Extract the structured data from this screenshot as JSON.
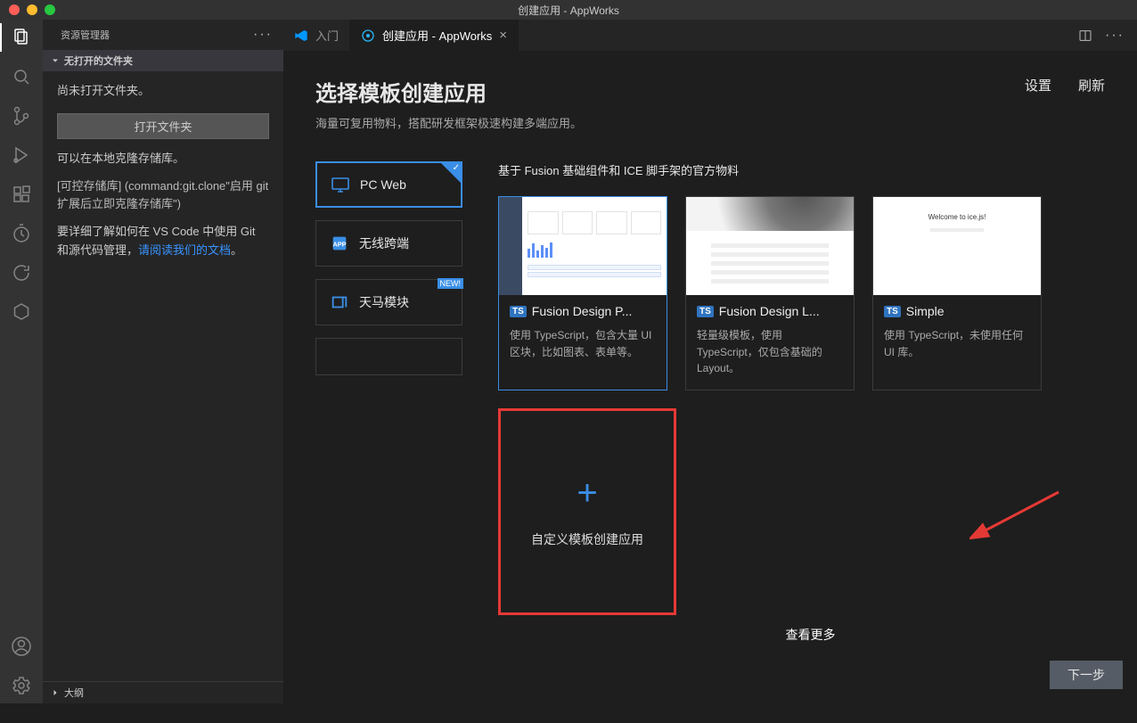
{
  "window": {
    "title": "创建应用 - AppWorks"
  },
  "sidebar": {
    "header": "资源管理器",
    "section": "无打开的文件夹",
    "no_folder": "尚未打开文件夹。",
    "open_folder_btn": "打开文件夹",
    "clone_hint": "可以在本地克隆存储库。",
    "clone_cmd1": "[可控存储库] (command:git.clone\"启用 git 扩展后立即克隆存储库\")",
    "git_hint_prefix": "要详细了解如何在 VS Code 中使用 Git 和源代码管理，",
    "git_link": "请阅读我们的文档",
    "git_hint_suffix": "。",
    "outline": "大纲"
  },
  "tabs": {
    "welcome": "入门",
    "appworks": "创建应用 - AppWorks"
  },
  "page": {
    "title": "选择模板创建应用",
    "subtitle": "海量可复用物料，搭配研发框架极速构建多端应用。",
    "settings": "设置",
    "refresh": "刷新",
    "next": "下一步"
  },
  "categories": {
    "pcweb": "PC Web",
    "wireless": "无线跨端",
    "tianma": "天马模块",
    "new_badge": "NEW!"
  },
  "templates": {
    "hint": "基于 Fusion 基础组件和 ICE 脚手架的官方物料",
    "ts": "TS",
    "items": [
      {
        "title": "Fusion Design P...",
        "desc": "使用 TypeScript，包含大量 UI 区块，比如图表、表单等。"
      },
      {
        "title": "Fusion Design L...",
        "desc": "轻量级模板，使用 TypeScript，仅包含基础的 Layout。"
      },
      {
        "title": "Simple",
        "desc": "使用 TypeScript，未使用任何 UI 库。"
      }
    ],
    "custom": "自定义模板创建应用",
    "more": "查看更多",
    "simple_thumb_title": "Welcome to ice.js!"
  }
}
